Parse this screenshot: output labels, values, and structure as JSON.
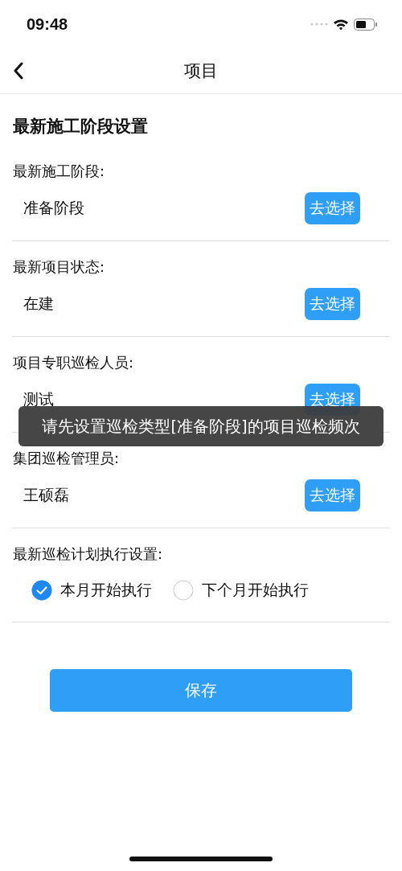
{
  "status_bar": {
    "time": "09:48"
  },
  "nav": {
    "title": "项目"
  },
  "section_title": "最新施工阶段设置",
  "fields": [
    {
      "label": "最新施工阶段:",
      "value": "准备阶段",
      "button": "去选择"
    },
    {
      "label": "最新项目状态:",
      "value": "在建",
      "button": "去选择"
    },
    {
      "label": "项目专职巡检人员:",
      "value": "测试",
      "button": "去选择"
    },
    {
      "label": "集团巡检管理员:",
      "value": "王硕磊",
      "button": "去选择"
    }
  ],
  "plan": {
    "label": "最新巡检计划执行设置:",
    "options": [
      {
        "label": "本月开始执行",
        "selected": true
      },
      {
        "label": "下个月开始执行",
        "selected": false
      }
    ]
  },
  "save_button": "保存",
  "toast": "请先设置巡检类型[准备阶段]的项目巡检频次"
}
